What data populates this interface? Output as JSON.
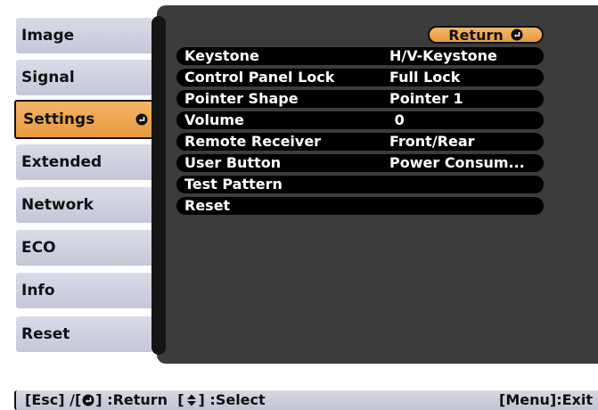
{
  "tabs": [
    {
      "label": "Image",
      "selected": false
    },
    {
      "label": "Signal",
      "selected": false
    },
    {
      "label": "Settings",
      "selected": true
    },
    {
      "label": "Extended",
      "selected": false
    },
    {
      "label": "Network",
      "selected": false
    },
    {
      "label": "ECO",
      "selected": false
    },
    {
      "label": "Info",
      "selected": false
    },
    {
      "label": "Reset",
      "selected": false
    }
  ],
  "return_button": {
    "label": "Return",
    "icon": "enter-icon"
  },
  "settings": [
    {
      "label": "Keystone",
      "value": "H/V-Keystone"
    },
    {
      "label": "Control Panel Lock",
      "value": "Full Lock"
    },
    {
      "label": "Pointer Shape",
      "value": "Pointer 1"
    },
    {
      "label": "Volume",
      "value": " 0"
    },
    {
      "label": "Remote Receiver",
      "value": "Front/Rear"
    },
    {
      "label": "User Button",
      "value": "Power Consum..."
    },
    {
      "label": "Test Pattern",
      "value": ""
    },
    {
      "label": "Reset",
      "value": ""
    }
  ],
  "statusbar": {
    "esc_text": "[Esc] /[",
    "return_text": "] :Return  [",
    "select_text": "] :Select",
    "exit_text": "[Menu]:Exit"
  },
  "colors": {
    "selected_tab": "#e89a3f",
    "tab": "#c5c7d8",
    "panel": "#3c3c3c",
    "row": "#000000"
  }
}
